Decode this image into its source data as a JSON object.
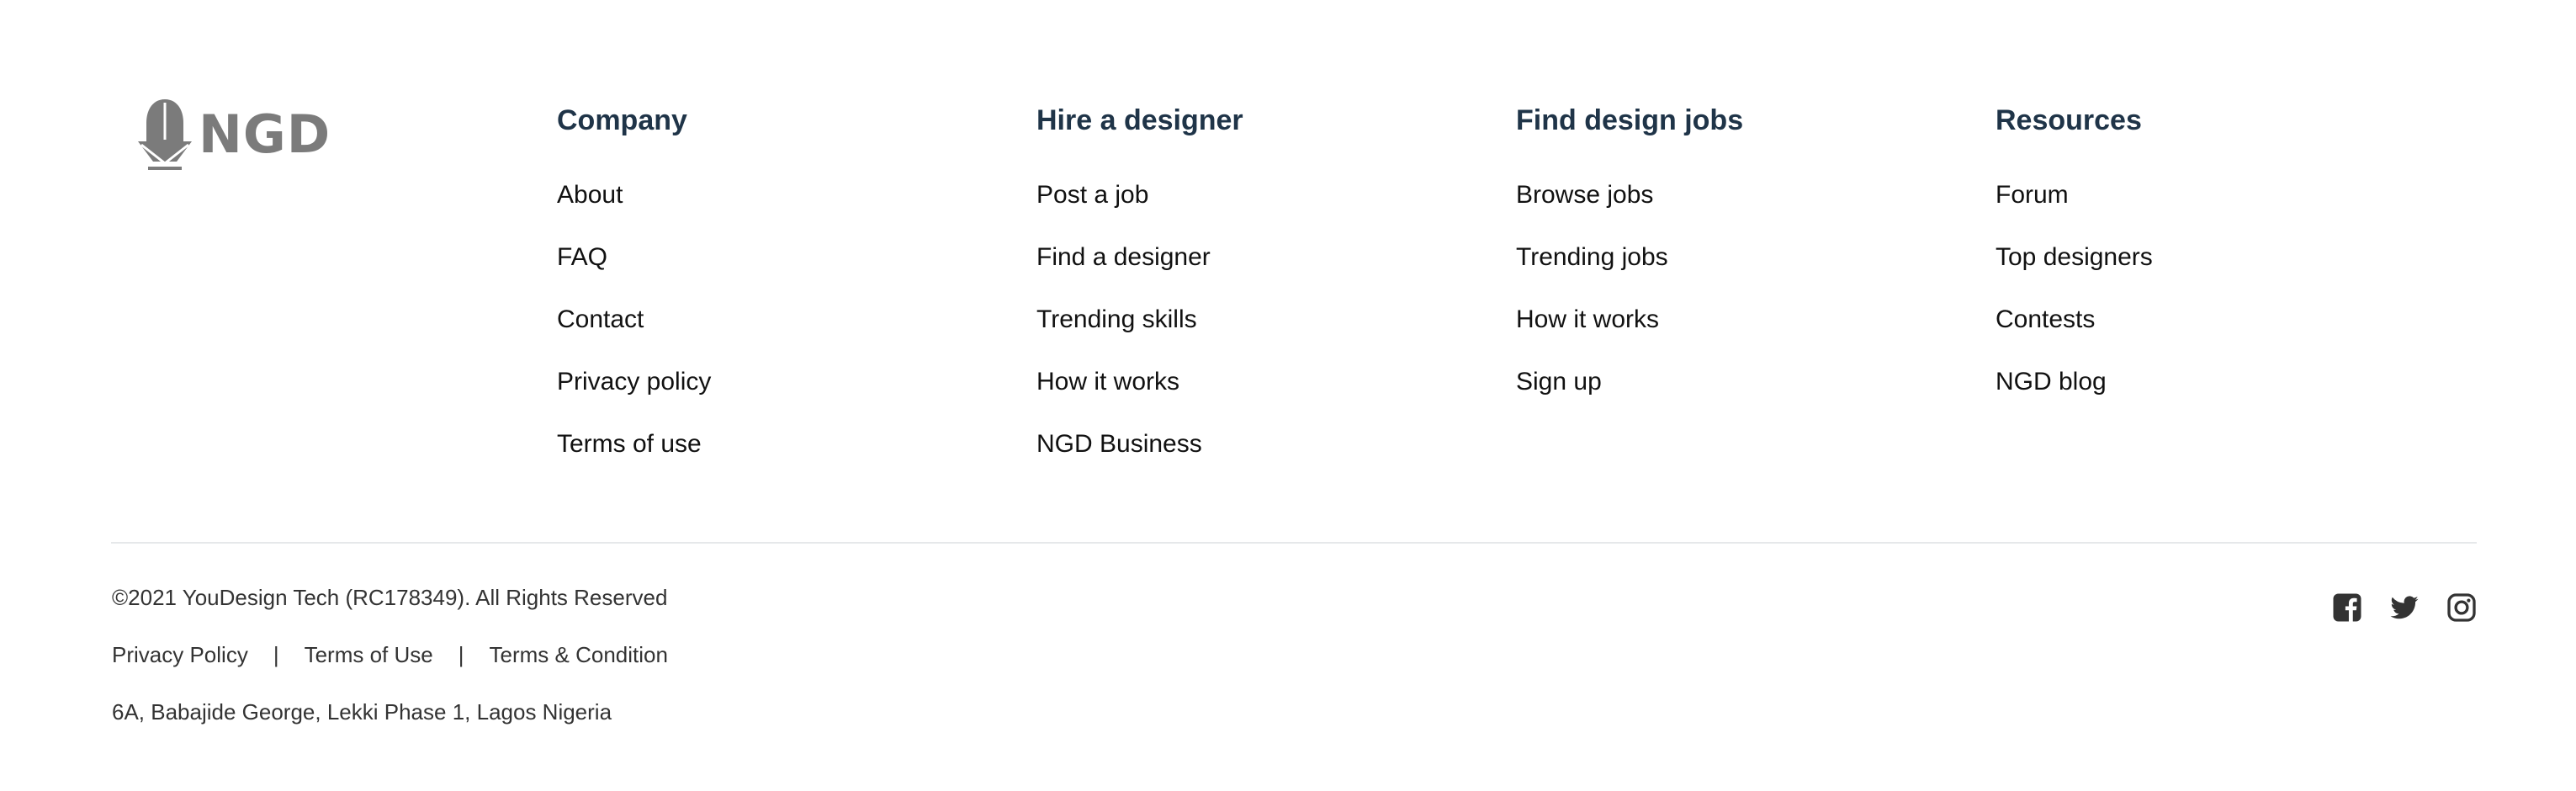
{
  "brand": {
    "logo_text": "NGD",
    "logo_color": "#7b7b7b"
  },
  "columns": [
    {
      "title": "Company",
      "links": [
        "About",
        "FAQ",
        "Contact",
        "Privacy policy",
        "Terms of use"
      ]
    },
    {
      "title": "Hire a designer",
      "links": [
        "Post a job",
        "Find a designer",
        "Trending skills",
        "How it works",
        "NGD Business"
      ]
    },
    {
      "title": "Find design jobs",
      "links": [
        "Browse jobs",
        "Trending jobs",
        "How it works",
        "Sign up"
      ]
    },
    {
      "title": "Resources",
      "links": [
        "Forum",
        "Top designers",
        "Contests",
        "NGD blog"
      ]
    }
  ],
  "bottom": {
    "copyright": "©2021 YouDesign Tech (RC178349). All Rights Reserved",
    "legal_links": [
      "Privacy Policy",
      "Terms of Use",
      "Terms & Condition"
    ],
    "separator": "|",
    "address": "6A, Babajide George, Lekki Phase 1, Lagos Nigeria"
  },
  "social": {
    "icons": [
      "facebook-icon",
      "twitter-icon",
      "instagram-icon"
    ],
    "color": "#333333"
  },
  "colors": {
    "heading": "#1f3448",
    "link": "#111111",
    "muted": "#333333",
    "divider": "#e6e8ea"
  }
}
